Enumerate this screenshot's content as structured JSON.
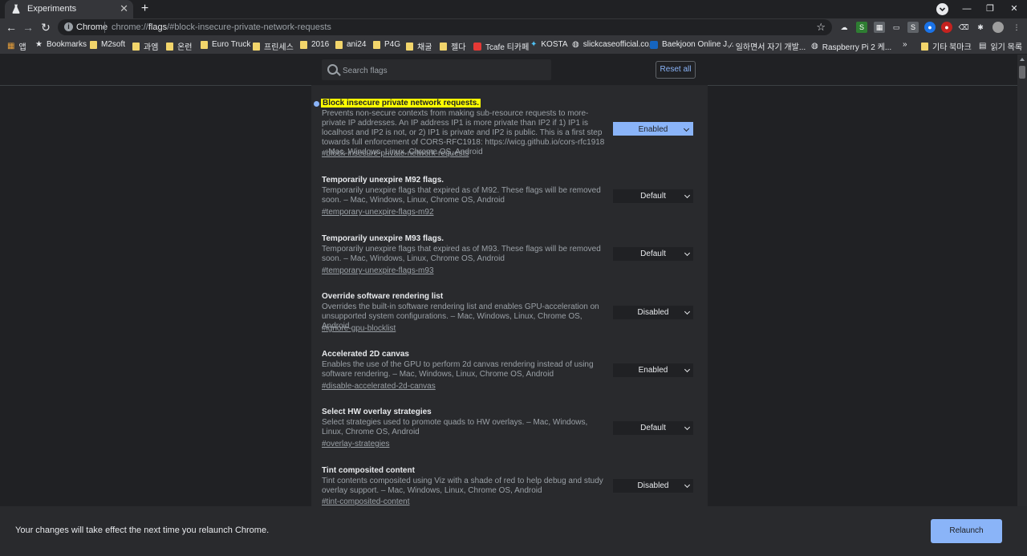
{
  "tab": {
    "title": "Experiments",
    "close": "✕"
  },
  "window": {
    "minimize": "—",
    "restore": "❐",
    "close": "✕"
  },
  "toolbar": {
    "chip": "Chrome",
    "url_prefix": "chrome://",
    "url_host": "flags",
    "url_rest": "/#block-insecure-private-network-requests"
  },
  "bookmarks": {
    "apps_label": "앱",
    "items": [
      "Bookmarks",
      "M2soft",
      "과엠",
      "온런",
      "Euro Truck",
      "프린세스",
      "2016",
      "ani24",
      "P4G",
      "채굴",
      "젤다",
      "Tcafe 티카페",
      "KOSTA",
      "slickcaseofficial.co...",
      "Baekjoon Online J...",
      "일하면서 자기 개발...",
      "Raspberry Pi 2 케..."
    ],
    "overflow": "»",
    "other": "기타 북마크",
    "reading": "읽기 목록"
  },
  "search": {
    "placeholder": "Search flags"
  },
  "reset_label": "Reset all",
  "flags": [
    {
      "title": "Block insecure private network requests.",
      "description": "Prevents non-secure contexts from making sub-resource requests to more-private IP addresses. An IP address IP1 is more private than IP2 if 1) IP1 is localhost and IP2 is not, or 2) IP1 is private and IP2 is public. This is a first step towards full enforcement of CORS-RFC1918: https://wicg.github.io/cors-rfc1918 – Mac, Windows, Linux, Chrome OS, Android",
      "link": "#block-insecure-private-network-requests",
      "value": "Enabled"
    },
    {
      "title": "Temporarily unexpire M92 flags.",
      "description": "Temporarily unexpire flags that expired as of M92. These flags will be removed soon. – Mac, Windows, Linux, Chrome OS, Android",
      "link": "#temporary-unexpire-flags-m92",
      "value": "Default"
    },
    {
      "title": "Temporarily unexpire M93 flags.",
      "description": "Temporarily unexpire flags that expired as of M93. These flags will be removed soon. – Mac, Windows, Linux, Chrome OS, Android",
      "link": "#temporary-unexpire-flags-m93",
      "value": "Default"
    },
    {
      "title": "Override software rendering list",
      "description": "Overrides the built-in software rendering list and enables GPU-acceleration on unsupported system configurations. – Mac, Windows, Linux, Chrome OS, Android",
      "link": "#ignore-gpu-blocklist",
      "value": "Disabled"
    },
    {
      "title": "Accelerated 2D canvas",
      "description": "Enables the use of the GPU to perform 2d canvas rendering instead of using software rendering. – Mac, Windows, Linux, Chrome OS, Android",
      "link": "#disable-accelerated-2d-canvas",
      "value": "Enabled"
    },
    {
      "title": "Select HW overlay strategies",
      "description": "Select strategies used to promote quads to HW overlays. – Mac, Windows, Linux, Chrome OS, Android",
      "link": "#overlay-strategies",
      "value": "Default"
    },
    {
      "title": "Tint composited content",
      "description": "Tint contents composited using Viz with a shade of red to help debug and study overlay support. – Mac, Windows, Linux, Chrome OS, Android",
      "link": "#tint-composited-content",
      "value": "Disabled"
    }
  ],
  "relaunch": {
    "message": "Your changes will take effect the next time you relaunch Chrome.",
    "button": "Relaunch"
  },
  "colors": {
    "accent": "#8ab4f8",
    "highlight": "#ffff00",
    "background": "#202124",
    "panel": "#292a2d"
  }
}
